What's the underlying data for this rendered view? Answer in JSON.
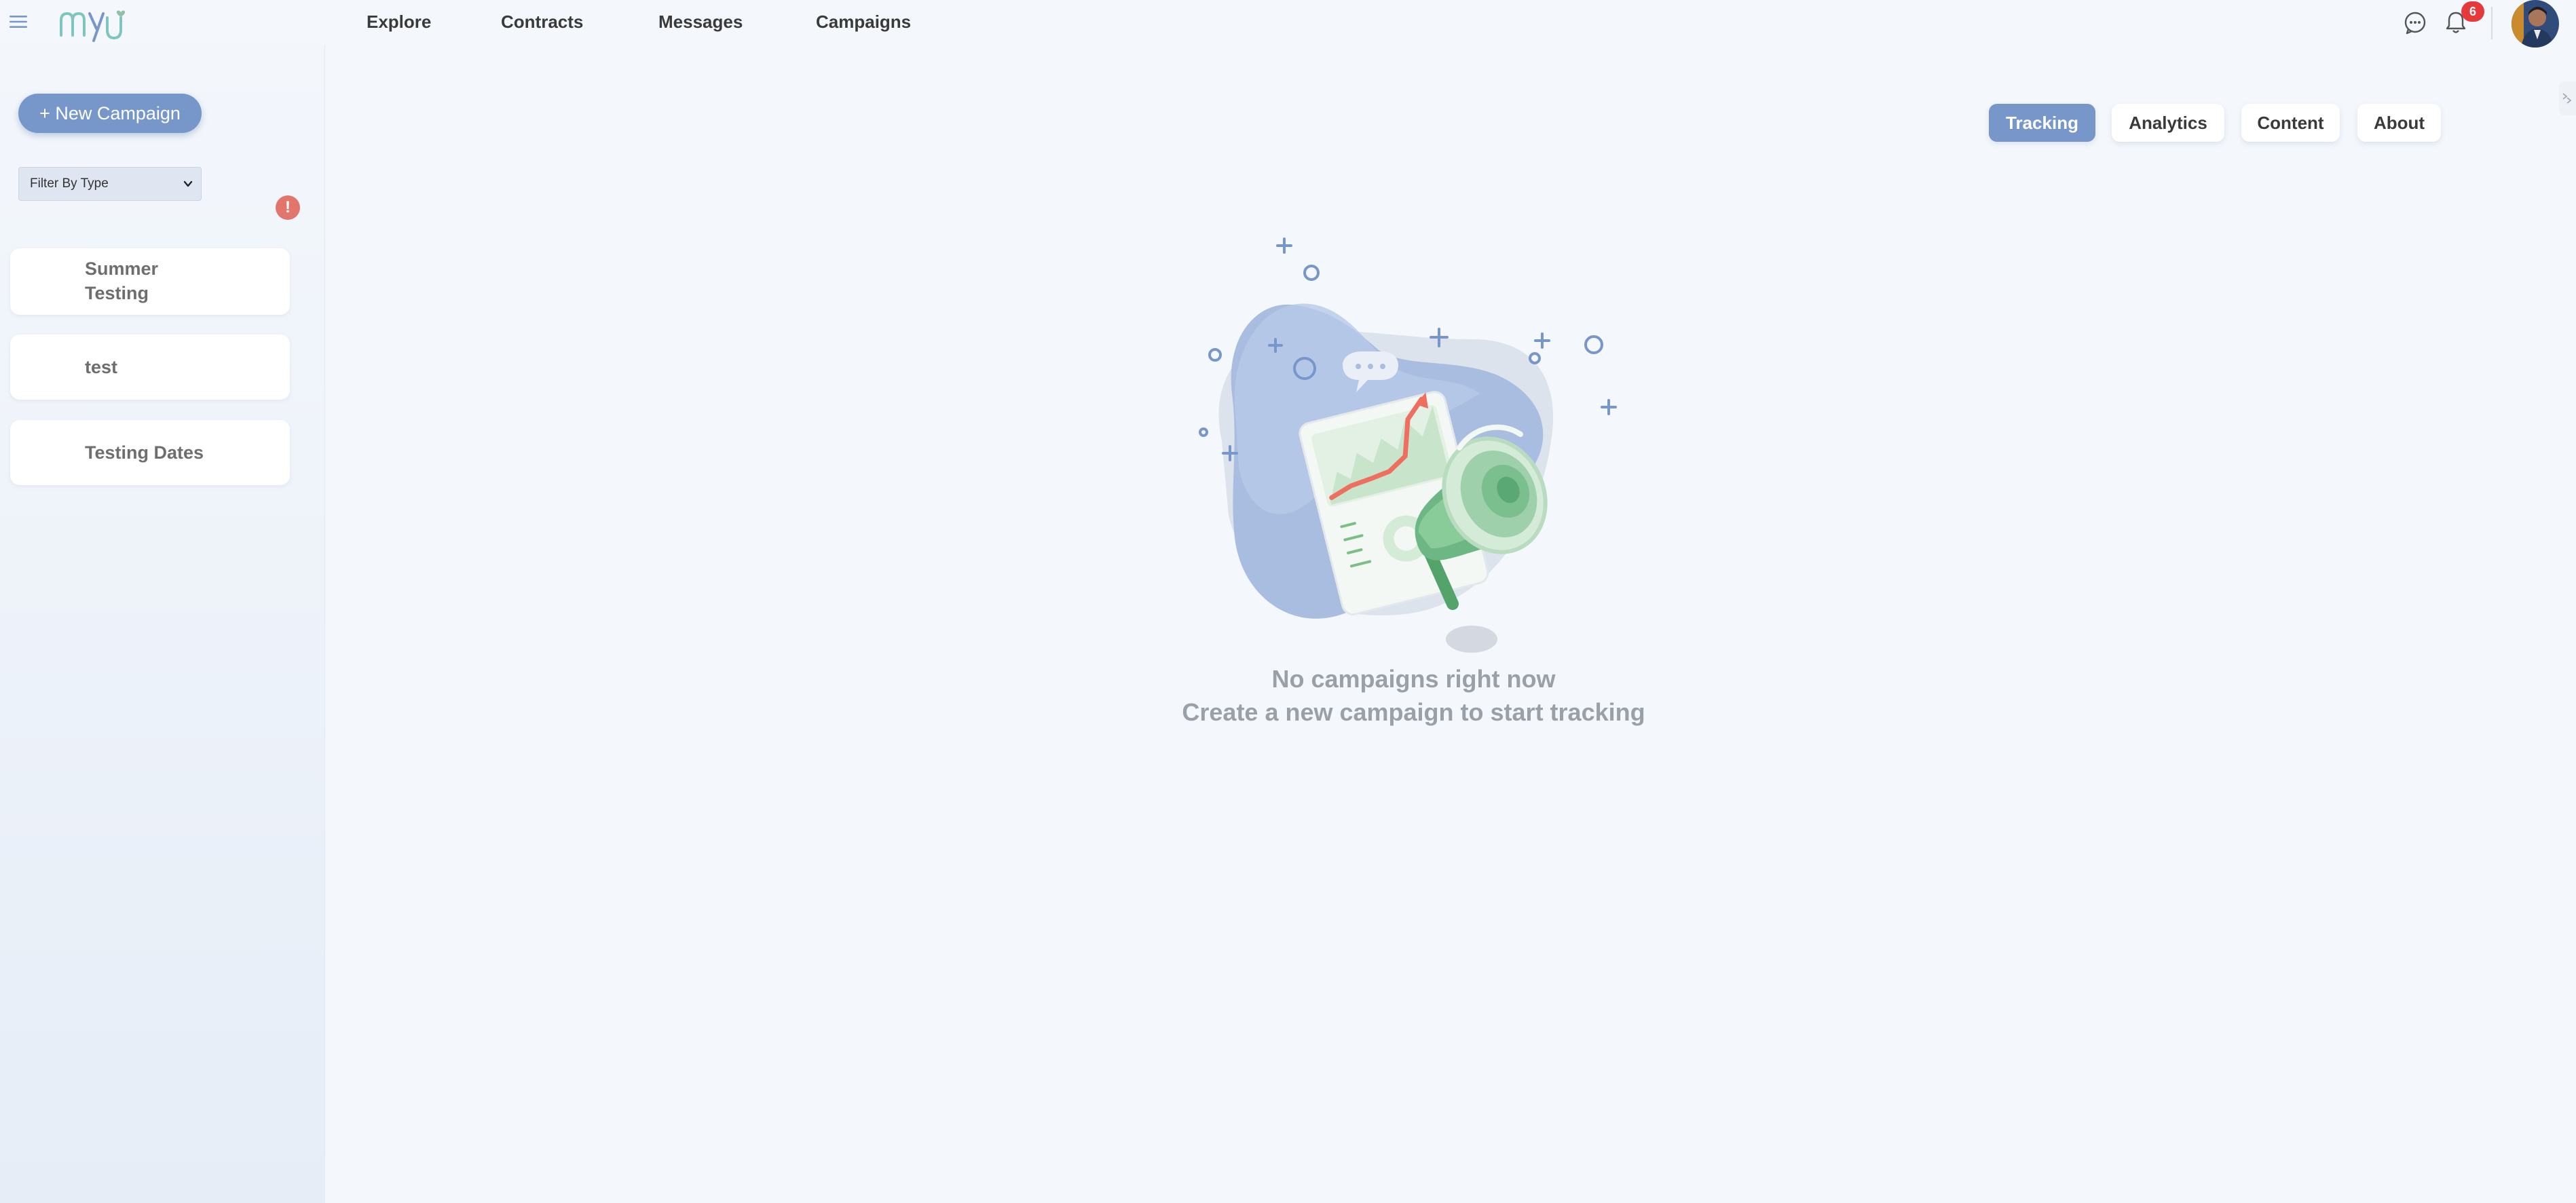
{
  "nav": {
    "items": [
      "Explore",
      "Contracts",
      "Messages",
      "Campaigns"
    ]
  },
  "header": {
    "notification_count": "6",
    "icons": [
      "menu-icon",
      "chat-icon",
      "bell-icon"
    ]
  },
  "sidebar": {
    "new_campaign_label": "+ New Campaign",
    "filter_value": "Filter By Type",
    "alert_symbol": "!",
    "campaigns": [
      {
        "title_line1": "Summer",
        "title_line2": "Testing"
      },
      {
        "title": "test"
      },
      {
        "title": "Testing Dates"
      }
    ]
  },
  "tabs": [
    "Tracking",
    "Analytics",
    "Content",
    "About"
  ],
  "active_tab": "Tracking",
  "empty_state": {
    "title": "No campaigns right now",
    "subtitle": "Create a new campaign to start tracking"
  },
  "colors": {
    "accent": "#7797cb",
    "background": "#f4f8fd",
    "badge_red": "#e5393b",
    "alert_coral": "#e3766c",
    "empty_text": "#9aa0a7"
  }
}
